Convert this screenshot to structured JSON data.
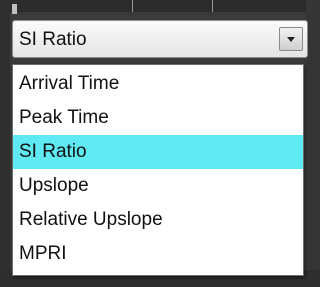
{
  "selector": {
    "value": "SI Ratio",
    "options": [
      {
        "label": "Arrival Time",
        "selected": false
      },
      {
        "label": "Peak Time",
        "selected": false
      },
      {
        "label": "SI Ratio",
        "selected": true
      },
      {
        "label": "Upslope",
        "selected": false
      },
      {
        "label": "Relative Upslope",
        "selected": false
      },
      {
        "label": "MPRI",
        "selected": false
      }
    ],
    "arrow_icon": "chevron-down-icon"
  },
  "colors": {
    "selected_highlight": "#5ee9f3",
    "background": "#3a3a3a"
  }
}
